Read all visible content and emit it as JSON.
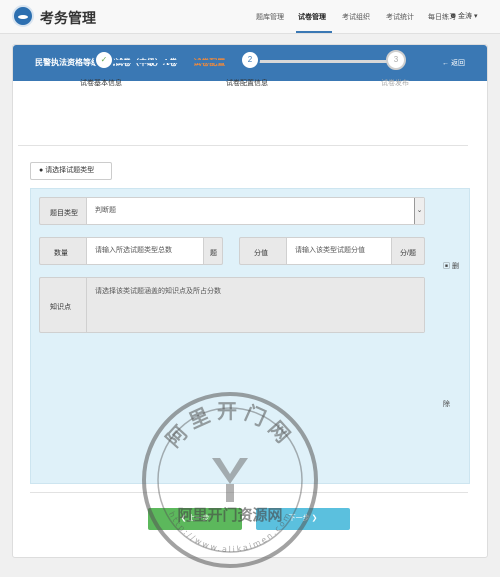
{
  "header": {
    "app_title": "考务管理",
    "nav": [
      "题库管理",
      "试卷管理",
      "考试组织",
      "考试统计",
      "每日练习"
    ],
    "user": "金涛 ▾"
  },
  "card": {
    "title_main": "民警执法资格等级考试试卷（中级）A卷——",
    "title_accent": "试卷配置",
    "back_label": "返回"
  },
  "steps": [
    {
      "label": "试卷基本信息",
      "marker": "✓",
      "state": "done"
    },
    {
      "label": "试卷配置信息",
      "marker": "2",
      "state": "active"
    },
    {
      "label": "试卷发布",
      "marker": "3",
      "state": "todo"
    }
  ],
  "config": {
    "select_type_label": "请选择试题类型",
    "type_label": "题目类型",
    "type_value": "判断题",
    "quantity_label": "数量",
    "quantity_placeholder": "请输入所选试题类型总数",
    "quantity_unit": "题",
    "score_label": "分值",
    "score_placeholder": "请输入该类型试题分值",
    "score_unit": "分/题",
    "knowledge_label": "知识点",
    "knowledge_placeholder": "请选择该类试题涵盖的知识点及所占分数",
    "delete_label": "删",
    "delete_label_2": "除"
  },
  "buttons": {
    "prev": "上一步",
    "next": "下一步"
  },
  "watermark": {
    "name": "阿里开门资源网",
    "arc_top": "阿里开门网",
    "url": "http://www.alikaimen.com"
  },
  "colors": {
    "header_blue": "#3a78b4",
    "step_done": "#6aa84f",
    "step_active": "#3a78b4",
    "panel_bg": "#dff1f9",
    "btn_prev": "#5cb85c",
    "btn_next": "#5bc0de"
  }
}
